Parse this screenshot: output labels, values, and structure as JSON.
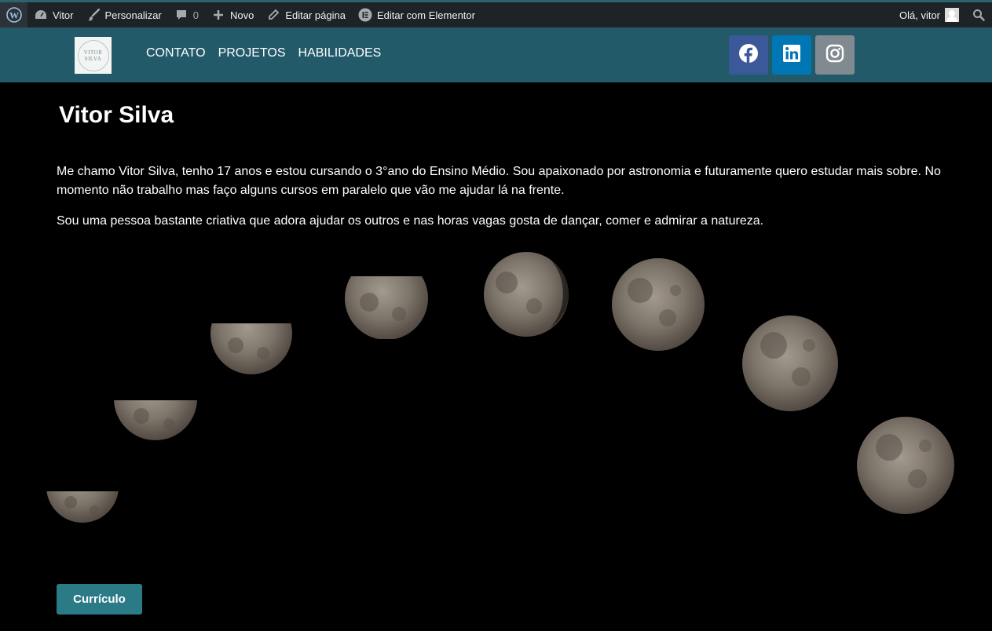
{
  "admin_bar": {
    "site_name": "Vitor",
    "customize": "Personalizar",
    "comments_count": "0",
    "new": "Novo",
    "edit_page": "Editar página",
    "edit_elementor": "Editar com Elementor",
    "greeting": "Olá, vitor"
  },
  "header": {
    "logo": {
      "line1": "VITOR",
      "line2": "SILVA"
    },
    "nav": [
      "CONTATO",
      "PROJETOS",
      "HABILIDADES"
    ],
    "social": [
      {
        "icon": "facebook-icon",
        "color": "#3b5998"
      },
      {
        "icon": "linkedin-icon",
        "color": "#0077b5"
      },
      {
        "icon": "instagram-icon",
        "color": "#818a91"
      }
    ]
  },
  "main": {
    "title": "Vitor Silva",
    "paragraphs": [
      "Me chamo Vitor Silva, tenho 17 anos e estou cursando o 3°ano do Ensino Médio. Sou apaixonado por astronomia e futuramente quero estudar mais sobre. No momento não trabalho mas faço alguns cursos em paralelo que vão me ajudar lá na frente.",
      "Sou uma pessoa bastante criativa que adora ajudar os outros e nas horas vagas gosta de dançar, comer e admirar a natureza."
    ],
    "button_label": "Currículo"
  }
}
